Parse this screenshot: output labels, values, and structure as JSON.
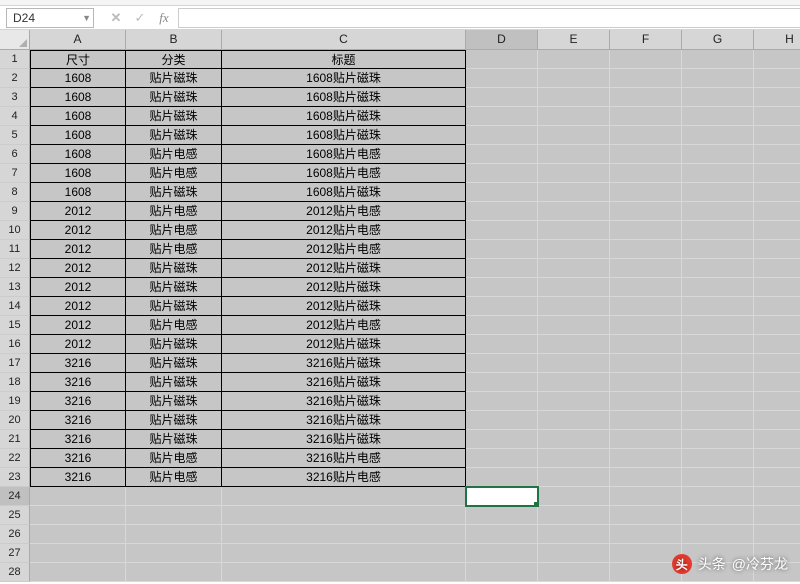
{
  "nameBox": {
    "value": "D24"
  },
  "formulaBar": {
    "cancelGlyph": "✕",
    "enterGlyph": "✓",
    "fxLabel": "fx",
    "value": ""
  },
  "selectAll": "",
  "columns": [
    {
      "letter": "A",
      "class": "col-A"
    },
    {
      "letter": "B",
      "class": "col-B"
    },
    {
      "letter": "C",
      "class": "col-C"
    },
    {
      "letter": "D",
      "class": "col-D"
    },
    {
      "letter": "E",
      "class": "col-E"
    },
    {
      "letter": "F",
      "class": "col-F"
    },
    {
      "letter": "G",
      "class": "col-G"
    },
    {
      "letter": "H",
      "class": "col-H"
    }
  ],
  "activeCell": {
    "row": 24,
    "col": "D"
  },
  "headerRow": {
    "A": "尺寸",
    "B": "分类",
    "C": "标题"
  },
  "dataRows": [
    {
      "n": 2,
      "A": "1608",
      "B": "贴片磁珠",
      "C": "1608贴片磁珠"
    },
    {
      "n": 3,
      "A": "1608",
      "B": "贴片磁珠",
      "C": "1608贴片磁珠"
    },
    {
      "n": 4,
      "A": "1608",
      "B": "贴片磁珠",
      "C": "1608贴片磁珠"
    },
    {
      "n": 5,
      "A": "1608",
      "B": "贴片磁珠",
      "C": "1608贴片磁珠"
    },
    {
      "n": 6,
      "A": "1608",
      "B": "贴片电感",
      "C": "1608贴片电感"
    },
    {
      "n": 7,
      "A": "1608",
      "B": "贴片电感",
      "C": "1608贴片电感"
    },
    {
      "n": 8,
      "A": "1608",
      "B": "贴片磁珠",
      "C": "1608贴片磁珠"
    },
    {
      "n": 9,
      "A": "2012",
      "B": "贴片电感",
      "C": "2012贴片电感"
    },
    {
      "n": 10,
      "A": "2012",
      "B": "贴片电感",
      "C": "2012贴片电感"
    },
    {
      "n": 11,
      "A": "2012",
      "B": "贴片电感",
      "C": "2012贴片电感"
    },
    {
      "n": 12,
      "A": "2012",
      "B": "贴片磁珠",
      "C": "2012贴片磁珠"
    },
    {
      "n": 13,
      "A": "2012",
      "B": "贴片磁珠",
      "C": "2012贴片磁珠"
    },
    {
      "n": 14,
      "A": "2012",
      "B": "贴片磁珠",
      "C": "2012贴片磁珠"
    },
    {
      "n": 15,
      "A": "2012",
      "B": "贴片电感",
      "C": "2012贴片电感"
    },
    {
      "n": 16,
      "A": "2012",
      "B": "贴片磁珠",
      "C": "2012贴片磁珠"
    },
    {
      "n": 17,
      "A": "3216",
      "B": "贴片磁珠",
      "C": "3216贴片磁珠"
    },
    {
      "n": 18,
      "A": "3216",
      "B": "贴片磁珠",
      "C": "3216贴片磁珠"
    },
    {
      "n": 19,
      "A": "3216",
      "B": "贴片磁珠",
      "C": "3216贴片磁珠"
    },
    {
      "n": 20,
      "A": "3216",
      "B": "贴片磁珠",
      "C": "3216贴片磁珠"
    },
    {
      "n": 21,
      "A": "3216",
      "B": "贴片磁珠",
      "C": "3216贴片磁珠"
    },
    {
      "n": 22,
      "A": "3216",
      "B": "贴片电感",
      "C": "3216贴片电感"
    },
    {
      "n": 23,
      "A": "3216",
      "B": "贴片电感",
      "C": "3216贴片电感"
    }
  ],
  "emptyRowStart": 24,
  "emptyRowEnd": 28,
  "watermark": {
    "prefix": "头条",
    "author": "@冷芬龙",
    "badge": "头"
  }
}
